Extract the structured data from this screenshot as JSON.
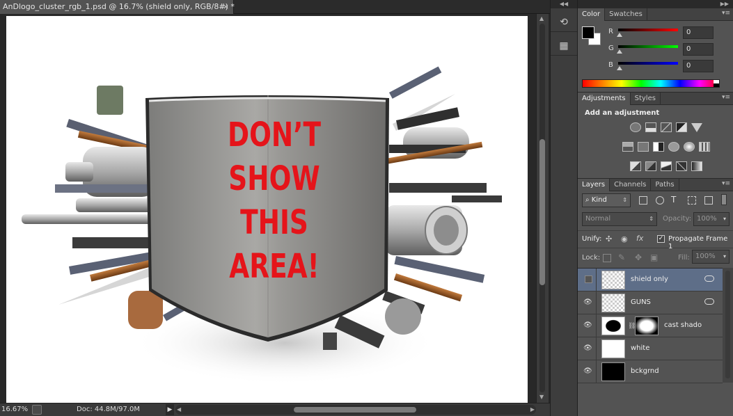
{
  "document": {
    "tab_title": "AnDlogo_cluster_rgb_1.psd @ 16.7% (shield only, RGB/8#) *",
    "tab_close": "×",
    "canvas_text": [
      "DON’T",
      "SHOW",
      "THIS",
      "AREA!"
    ]
  },
  "status": {
    "zoom": "16.67%",
    "doc_size": "Doc: 44.8M/97.0M",
    "arrow": "▶"
  },
  "color_panel": {
    "tabs": [
      "Color",
      "Swatches"
    ],
    "active_tab": "Color",
    "foreground": "#000000",
    "background": "#ffffff",
    "channels": [
      {
        "label": "R",
        "value": "0",
        "color": "#ff0000"
      },
      {
        "label": "G",
        "value": "0",
        "color": "#00ff00"
      },
      {
        "label": "B",
        "value": "0",
        "color": "#0000ff"
      }
    ]
  },
  "adjustments_panel": {
    "tabs": [
      "Adjustments",
      "Styles"
    ],
    "heading": "Add an adjustment",
    "icons_row1": [
      "brightness-contrast-icon",
      "levels-icon",
      "curves-icon",
      "exposure-icon",
      "vibrance-icon"
    ],
    "icons_row2": [
      "hue-saturation-icon",
      "color-balance-icon",
      "black-white-icon",
      "photo-filter-icon",
      "channel-mixer-icon",
      "color-lookup-icon"
    ],
    "icons_row3": [
      "invert-icon",
      "posterize-icon",
      "threshold-icon",
      "selective-color-icon",
      "gradient-map-icon"
    ]
  },
  "layers_panel": {
    "tabs": [
      "Layers",
      "Channels",
      "Paths"
    ],
    "filter_kind": "Kind",
    "blend_mode": "Normal",
    "opacity_label": "Opacity:",
    "opacity_value": "100%",
    "unify_label": "Unify:",
    "propagate_label": "Propagate Frame 1",
    "lock_label": "Lock:",
    "fill_label": "Fill:",
    "fill_value": "100%",
    "layers": [
      {
        "name": "shield only",
        "selected": true,
        "visible": false,
        "linked": true
      },
      {
        "name": "GUNS",
        "selected": false,
        "visible": true,
        "linked": true
      },
      {
        "name": "cast shado",
        "selected": false,
        "visible": true,
        "linked": false
      },
      {
        "name": "white",
        "selected": false,
        "visible": true,
        "linked": false
      },
      {
        "name": "bckgrnd",
        "selected": false,
        "visible": true,
        "linked": false
      }
    ]
  },
  "accent_text_color": "#e5141a"
}
